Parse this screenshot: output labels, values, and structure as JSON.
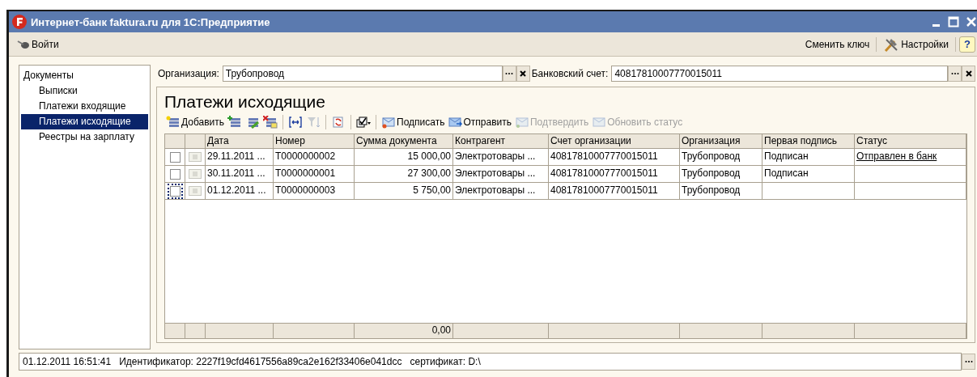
{
  "window": {
    "title": "Интернет-банк faktura.ru для 1С:Предприятие"
  },
  "top_bar": {
    "left": [
      {
        "label": "Войти",
        "kind": "login"
      }
    ],
    "right": [
      {
        "label": "Сменить ключ",
        "kind": "text"
      },
      {
        "label": "Настройки",
        "kind": "tools"
      },
      {
        "label": "?",
        "kind": "help"
      }
    ]
  },
  "sidebar": {
    "items": [
      {
        "label": "Документы",
        "selected": false,
        "children": [
          {
            "label": "Выписки",
            "selected": false
          },
          {
            "label": "Платежи входящие",
            "selected": false
          },
          {
            "label": "Платежи исходящие",
            "selected": true
          },
          {
            "label": "Реестры на зарплату",
            "selected": false
          }
        ]
      }
    ]
  },
  "filters": [
    {
      "label": "Организация:",
      "value": "Трубопровод"
    },
    {
      "label": "Банковский счет:",
      "value": "40817810007770015011"
    }
  ],
  "heading": "Платежи исходящие",
  "toolbar": [
    {
      "kind": "add",
      "label": "Добавить",
      "disabled": false
    },
    {
      "kind": "add-copy",
      "disabled": false
    },
    {
      "kind": "edit",
      "disabled": false
    },
    {
      "kind": "delete",
      "disabled": false
    },
    {
      "kind": "separator"
    },
    {
      "kind": "range",
      "disabled": false
    },
    {
      "kind": "filter",
      "disabled": true
    },
    {
      "kind": "separator"
    },
    {
      "kind": "refresh",
      "disabled": false
    },
    {
      "kind": "separator"
    },
    {
      "kind": "check-menu",
      "disabled": false
    },
    {
      "kind": "separator"
    },
    {
      "kind": "sign",
      "label": "Подписать",
      "disabled": false
    },
    {
      "kind": "send",
      "label": "Отправить",
      "disabled": false
    },
    {
      "kind": "confirm",
      "label": "Подтвердить",
      "disabled": true
    },
    {
      "kind": "update",
      "label": "Обновить статус",
      "disabled": true
    }
  ],
  "table": {
    "columns": [
      "Дата",
      "Номер",
      "Сумма документа",
      "Контрагент",
      "Счет организации",
      "Организация",
      "Первая подпись",
      "Статус"
    ],
    "rows": [
      {
        "checked": false,
        "selected": false,
        "cells": [
          "29.11.2011 ...",
          "T0000000002",
          "15 000,00",
          "Электротовары ...",
          "40817810007770015011",
          "Трубопровод",
          "Подписан",
          "Отправлен в банк"
        ]
      },
      {
        "checked": false,
        "selected": false,
        "cells": [
          "30.11.2011 ...",
          "T0000000001",
          "27 300,00",
          "Электротовары ...",
          "40817810007770015011",
          "Трубопровод",
          "Подписан",
          ""
        ]
      },
      {
        "checked": false,
        "selected": true,
        "cells": [
          "01.12.2011 ...",
          "T0000000003",
          "5 750,00",
          "Электротовары ...",
          "40817810007770015011",
          "Трубопровод",
          "",
          ""
        ]
      }
    ],
    "total": "0,00"
  },
  "status_bar": "01.12.2011 16:51:41   Идентификатор: 2227f19cfd4617556a89ca2e162f33406e041dcc   сертификат: D:\\"
}
